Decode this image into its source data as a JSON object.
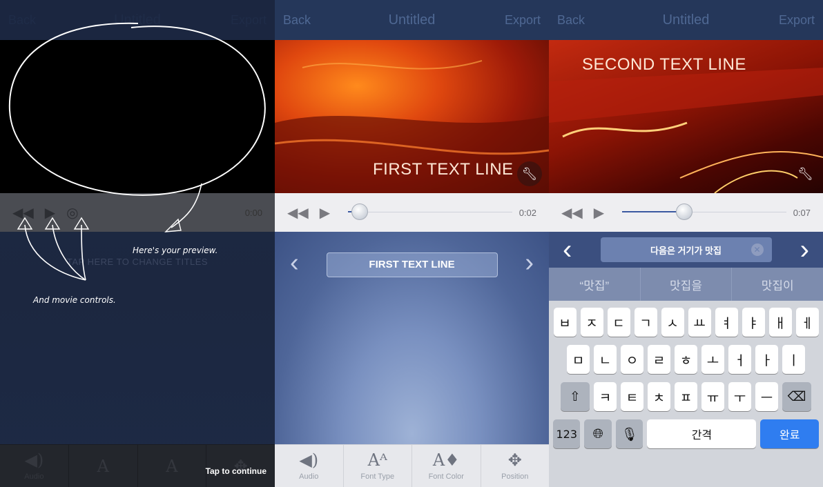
{
  "nav": {
    "back": "Back",
    "title": "Untitled",
    "export": "Export"
  },
  "panel1": {
    "time": "0:00",
    "tap_hint": "TAP HERE TO CHANGE TITLES",
    "annotation_preview": "Here's your preview.",
    "annotation_controls": "And movie controls.",
    "tap_continue": "Tap to continue"
  },
  "panel2": {
    "overlay_text": "FIRST TEXT LINE",
    "time": "0:02",
    "progress": 0.07,
    "title_field": "FIRST TEXT LINE"
  },
  "panel3": {
    "overlay_text": "SECOND TEXT LINE",
    "time": "0:07",
    "progress": 0.38,
    "input_value": "다음은 거기가 맛집",
    "suggestions": [
      "“맛집”",
      "맛집을",
      "맛집이"
    ],
    "keys_row1": [
      "ㅂ",
      "ㅈ",
      "ㄷ",
      "ㄱ",
      "ㅅ",
      "ㅛ",
      "ㅕ",
      "ㅑ",
      "ㅐ",
      "ㅔ"
    ],
    "keys_row2": [
      "ㅁ",
      "ㄴ",
      "ㅇ",
      "ㄹ",
      "ㅎ",
      "ㅗ",
      "ㅓ",
      "ㅏ",
      "ㅣ"
    ],
    "keys_row3": [
      "ㅋ",
      "ㅌ",
      "ㅊ",
      "ㅍ",
      "ㅠ",
      "ㅜ",
      "ㅡ"
    ],
    "key_numbers": "123",
    "key_space": "간격",
    "key_done": "완료"
  },
  "tools": [
    {
      "label": "Audio",
      "icon": "speaker-icon"
    },
    {
      "label": "Font Type",
      "icon": "font-type-icon"
    },
    {
      "label": "Font Color",
      "icon": "font-color-icon"
    },
    {
      "label": "Position",
      "icon": "position-icon"
    }
  ],
  "colors": {
    "navbar": "#25375a",
    "accent": "#2f7df0",
    "scrub_fill": "#3a58a0"
  }
}
